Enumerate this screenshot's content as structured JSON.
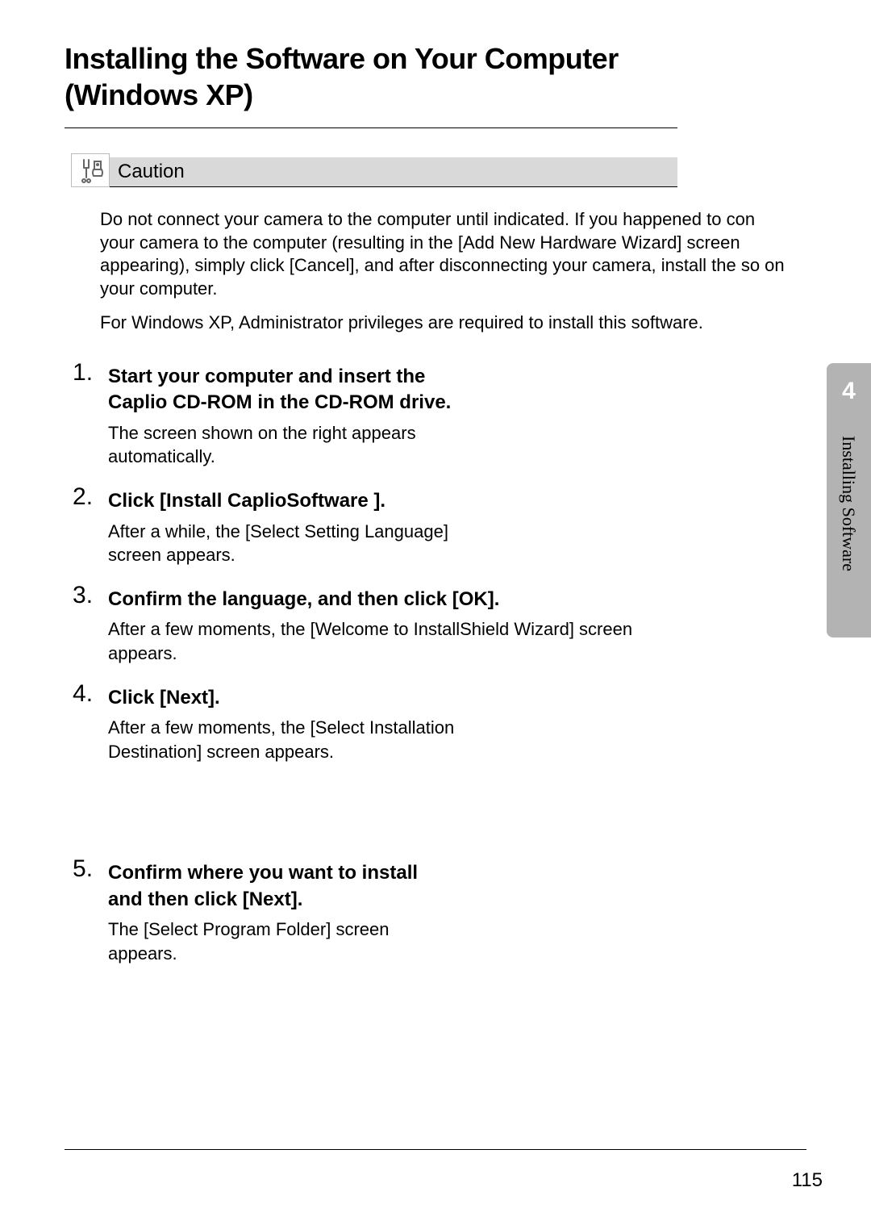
{
  "title": "Installing the Software on Your Computer (Windows XP)",
  "caution": {
    "label": "Caution",
    "para1": "Do not connect your camera to the computer until indicated. If you happened to con your camera to the computer (resulting in the [Add New Hardware Wizard] screen appearing), simply click [Cancel], and after disconnecting your camera, install the so on your computer.",
    "para2": "For Windows XP, Administrator privileges are required to install this software."
  },
  "steps": [
    {
      "head": "Start your computer and insert the Caplio  CD-ROM in the CD-ROM drive.",
      "body": "The screen shown on the right appears automatically."
    },
    {
      "head": "Click [Install CaplioSoftware ].",
      "body": "After a while, the [Select Setting Language] screen appears."
    },
    {
      "head": "Confirm the language, and then click [OK].",
      "body": "After a few moments, the [Welcome to InstallShield Wizard] screen appears.",
      "wide": true
    },
    {
      "head": "Click [Next].",
      "body": "After a few moments, the [Select Installation Destination] screen appears."
    },
    {
      "head": "Confirm where you want to install and then click [Next].",
      "body": "The [Select Program Folder] screen appears."
    }
  ],
  "sidebar": {
    "chapter_number": "4",
    "chapter_title": "Installing Software"
  },
  "page_number": "115"
}
